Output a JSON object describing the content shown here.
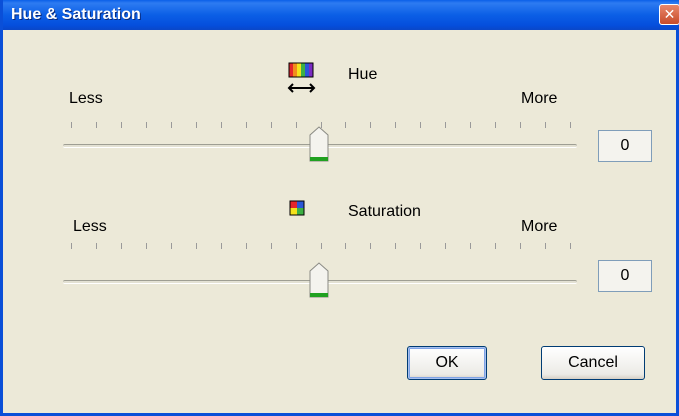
{
  "window": {
    "title": "Hue & Saturation",
    "close_glyph": "✕"
  },
  "hue": {
    "label": "Hue",
    "icon": "hue-spectrum-icon",
    "less_label": "Less",
    "more_label": "More",
    "value": "0",
    "slider_position": 0.5
  },
  "saturation": {
    "label": "Saturation",
    "icon": "saturation-color-squares-icon",
    "less_label": "Less",
    "more_label": "More",
    "value": "0",
    "slider_position": 0.5
  },
  "buttons": {
    "ok_label": "OK",
    "cancel_label": "Cancel"
  },
  "colors": {
    "titlebar_blue": "#0A5FE8",
    "dialog_bg": "#ECE9D8",
    "close_red": "#C74B2A",
    "thumb_green": "#21A121"
  }
}
